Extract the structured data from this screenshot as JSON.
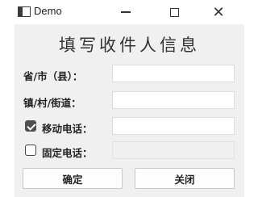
{
  "window": {
    "title": "Demo",
    "minimize_glyph": "",
    "maximize_glyph": "",
    "close_glyph": "✕"
  },
  "form": {
    "heading": "填写收件人信息",
    "province_label": "省/市（县）：",
    "province_value": "",
    "street_label": "镇/村/街道：",
    "street_value": "",
    "mobile_label": "移动电话：",
    "mobile_checked": true,
    "mobile_value": "",
    "landline_label": "固定电话：",
    "landline_checked": false,
    "landline_value": ""
  },
  "buttons": {
    "ok_label": "确定",
    "close_label": "关闭"
  }
}
